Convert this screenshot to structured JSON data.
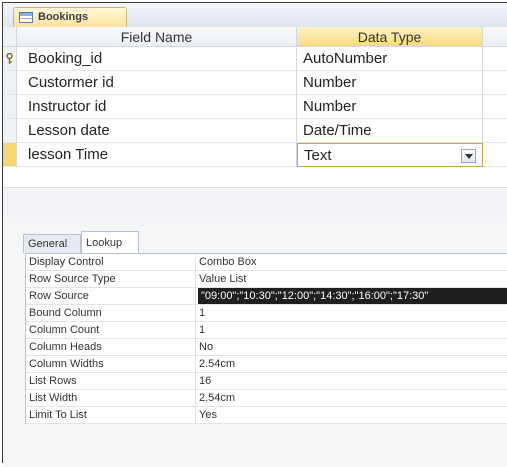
{
  "document_tab": {
    "title": "Bookings"
  },
  "grid": {
    "headers": {
      "field_name": "Field Name",
      "data_type": "Data Type"
    },
    "rows": [
      {
        "name": "Booking_id",
        "type": "AutoNumber",
        "primary_key": true
      },
      {
        "name": "Custormer id",
        "type": "Number"
      },
      {
        "name": "Instructor id",
        "type": "Number"
      },
      {
        "name": "Lesson date",
        "type": "Date/Time"
      },
      {
        "name": "lesson Time",
        "type": "Text",
        "current": true
      }
    ]
  },
  "property_tabs": {
    "general": "General",
    "lookup": "Lookup"
  },
  "properties": [
    {
      "label": "Display Control",
      "value": "Combo Box"
    },
    {
      "label": "Row Source Type",
      "value": "Value List"
    },
    {
      "label": "Row Source",
      "value": "\"09:00\";\"10:30\";\"12:00\";\"14:30\";\"16:00\";\"17:30\""
    },
    {
      "label": "Bound Column",
      "value": "1"
    },
    {
      "label": "Column Count",
      "value": "1"
    },
    {
      "label": "Column Heads",
      "value": "No"
    },
    {
      "label": "Column Widths",
      "value": "2.54cm"
    },
    {
      "label": "List Rows",
      "value": "16"
    },
    {
      "label": "List Width",
      "value": "2.54cm"
    },
    {
      "label": "Limit To List",
      "value": "Yes"
    }
  ],
  "colors": {
    "accent": "#f7d76d",
    "selected_value_bg": "#1f1f1f"
  }
}
